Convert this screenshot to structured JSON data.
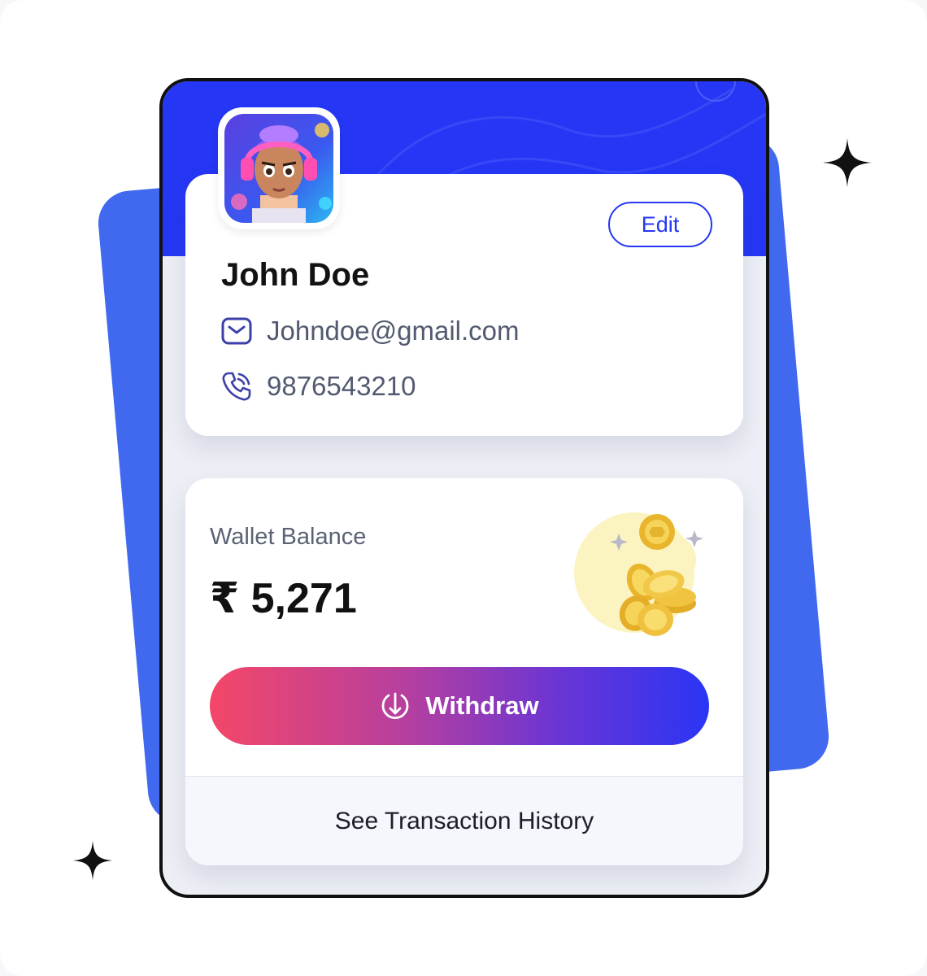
{
  "profile": {
    "name": "John Doe",
    "email": "Johndoe@gmail.com",
    "phone": "9876543210",
    "edit_label": "Edit"
  },
  "wallet": {
    "label": "Wallet Balance",
    "amount": "₹ 5,271",
    "withdraw_label": "Withdraw",
    "history_label": "See Transaction History"
  },
  "icons": {
    "email": "mail-icon",
    "phone": "phone-call-icon",
    "withdraw": "download-circle-icon",
    "coins": "gold-coins-illustration",
    "sparkle": "sparkle-star-icon"
  },
  "colors": {
    "brand_blue": "#2537f5",
    "background_shape": "#4069ef",
    "gradient_start": "#f44768",
    "gradient_end": "#2a35f5",
    "coin_gold": "#f2c94c"
  }
}
